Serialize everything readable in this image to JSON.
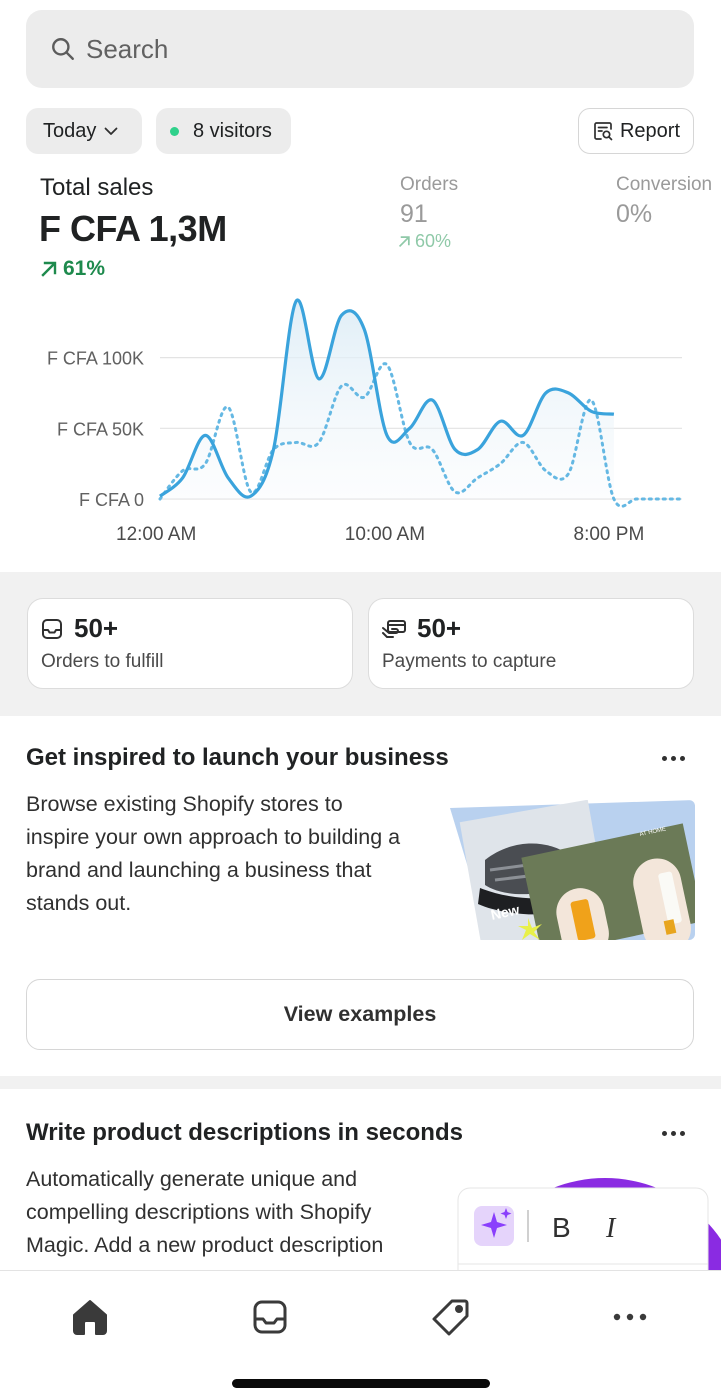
{
  "search": {
    "placeholder": "Search",
    "icon": "search-icon"
  },
  "filters": {
    "date_range": "Today",
    "visitors": "8 visitors",
    "live_dot_color": "#2fd18b",
    "report_label": "Report"
  },
  "metrics": {
    "total_sales": {
      "label": "Total sales",
      "value": "F CFA 1,3M",
      "change": "61%",
      "trend": "up",
      "color": "#1e8a4d"
    },
    "orders": {
      "label": "Orders",
      "value": "91",
      "change": "60%",
      "trend": "up"
    },
    "conversion": {
      "label": "Conversion",
      "value": "0%"
    }
  },
  "chart_data": {
    "type": "line",
    "y_tick_labels": [
      "F CFA 100K",
      "F CFA 50K",
      "F CFA 0"
    ],
    "x_tick_labels": [
      "12:00 AM",
      "10:00 AM",
      "8:00 PM"
    ],
    "ylim": [
      0,
      145000
    ],
    "grid": true,
    "series_colors": [
      "#3aa3dc",
      "#65b8e3"
    ],
    "series": [
      {
        "style": "solid",
        "x": [
          0,
          1,
          2,
          3,
          4,
          5,
          6,
          7,
          8,
          9,
          10,
          11,
          12,
          13,
          14,
          15,
          16,
          17,
          18,
          19,
          20,
          21,
          22,
          23
        ],
        "values": [
          2000,
          15000,
          45000,
          15000,
          2000,
          35000,
          140000,
          85000,
          130000,
          120000,
          45000,
          50000,
          70000,
          35000,
          35000,
          55000,
          45000,
          75000,
          75000,
          62000,
          60000,
          60000,
          60000,
          60000
        ]
      },
      {
        "style": "dotted",
        "x": [
          0,
          1,
          2,
          3,
          4,
          5,
          6,
          7,
          8,
          9,
          10,
          11,
          12,
          13,
          14,
          15,
          16,
          17,
          18,
          19,
          20,
          21,
          22,
          23
        ],
        "values": [
          0,
          20000,
          25000,
          65000,
          5000,
          35000,
          40000,
          40000,
          80000,
          72000,
          95000,
          40000,
          35000,
          5000,
          15000,
          25000,
          40000,
          20000,
          18000,
          70000,
          0,
          0,
          0,
          0
        ]
      }
    ]
  },
  "tiles": [
    {
      "icon": "inbox-icon",
      "count": "50+",
      "label": "Orders to fulfill"
    },
    {
      "icon": "payment-icon",
      "count": "50+",
      "label": "Payments to capture"
    }
  ],
  "cards": {
    "inspire": {
      "title": "Get inspired to launch your business",
      "body_lines": [
        "Browse existing Shopify stores to",
        "inspire your own approach to building a",
        "brand and launching a business that",
        "stands out."
      ],
      "button": "View examples",
      "image_text": [
        "New",
        "AT HOME"
      ]
    },
    "magic": {
      "title": "Write product descriptions in seconds",
      "body_lines": [
        "Automatically generate unique and",
        "compelling descriptions with Shopify",
        "Magic. Add a new product description"
      ],
      "toolbar": {
        "bold": "B",
        "italic": "I"
      }
    }
  },
  "bottom_nav": [
    "home-icon",
    "orders-icon",
    "products-icon",
    "more-icon"
  ]
}
